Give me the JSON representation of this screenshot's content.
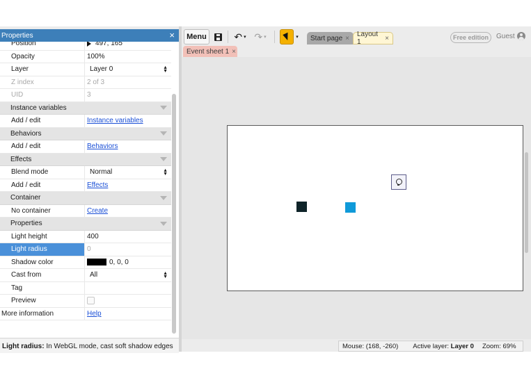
{
  "properties_panel": {
    "title": "Properties",
    "close_glyph": "×",
    "rows": {
      "position": {
        "label": "Position",
        "value": "497, 165"
      },
      "opacity": {
        "label": "Opacity",
        "value": "100%"
      },
      "layer": {
        "label": "Layer",
        "value": "Layer 0"
      },
      "z_index": {
        "label": "Z index",
        "value": "2 of 3"
      },
      "uid": {
        "label": "UID",
        "value": "3"
      },
      "instance_variables_section": {
        "label": "Instance variables"
      },
      "instance_variables_edit": {
        "label": "Add / edit",
        "value": "Instance variables"
      },
      "behaviors_section": {
        "label": "Behaviors"
      },
      "behaviors_edit": {
        "label": "Add / edit",
        "value": "Behaviors"
      },
      "effects_section": {
        "label": "Effects"
      },
      "blend_mode": {
        "label": "Blend mode",
        "value": "Normal"
      },
      "effects_edit": {
        "label": "Add / edit",
        "value": "Effects"
      },
      "container_section": {
        "label": "Container"
      },
      "no_container": {
        "label": "No container",
        "value": "Create"
      },
      "properties_section": {
        "label": "Properties"
      },
      "light_height": {
        "label": "Light height",
        "value": "400"
      },
      "light_radius": {
        "label": "Light radius",
        "value": "0"
      },
      "shadow_color": {
        "label": "Shadow color",
        "value": "0, 0, 0",
        "swatch": "#000000"
      },
      "cast_from": {
        "label": "Cast from",
        "value": "All"
      },
      "tag": {
        "label": "Tag",
        "value": ""
      },
      "preview": {
        "label": "Preview",
        "checked": false
      },
      "more_information": {
        "label": "More information",
        "value": "Help"
      }
    },
    "footer": {
      "bold": "Light radius:",
      "text": " In WebGL mode, cast soft shadow edges"
    }
  },
  "toolbar": {
    "menu_label": "Menu",
    "undo_glyph": "↶",
    "redo_glyph": "↷",
    "dropdown_glyph": "▾",
    "tabs": [
      {
        "label": "Start page",
        "close": "×"
      },
      {
        "label": "Layout 1",
        "close": "×"
      }
    ],
    "edition_badge": "Free edition",
    "user_label": "Guest"
  },
  "sub_tab": {
    "label": "Event sheet 1",
    "close": "×"
  },
  "statusbar": {
    "mouse": "Mouse: (168, -260)",
    "active_layer_label": "Active layer: ",
    "active_layer_value": "Layer 0",
    "zoom": "Zoom: 69%"
  },
  "colors": {
    "panel_header": "#3d7fb9",
    "selected_row": "#4a90d9",
    "pointer_tool": "#f5b100",
    "sprite_dark": "#0f2429",
    "sprite_blue": "#0f9ad9"
  }
}
